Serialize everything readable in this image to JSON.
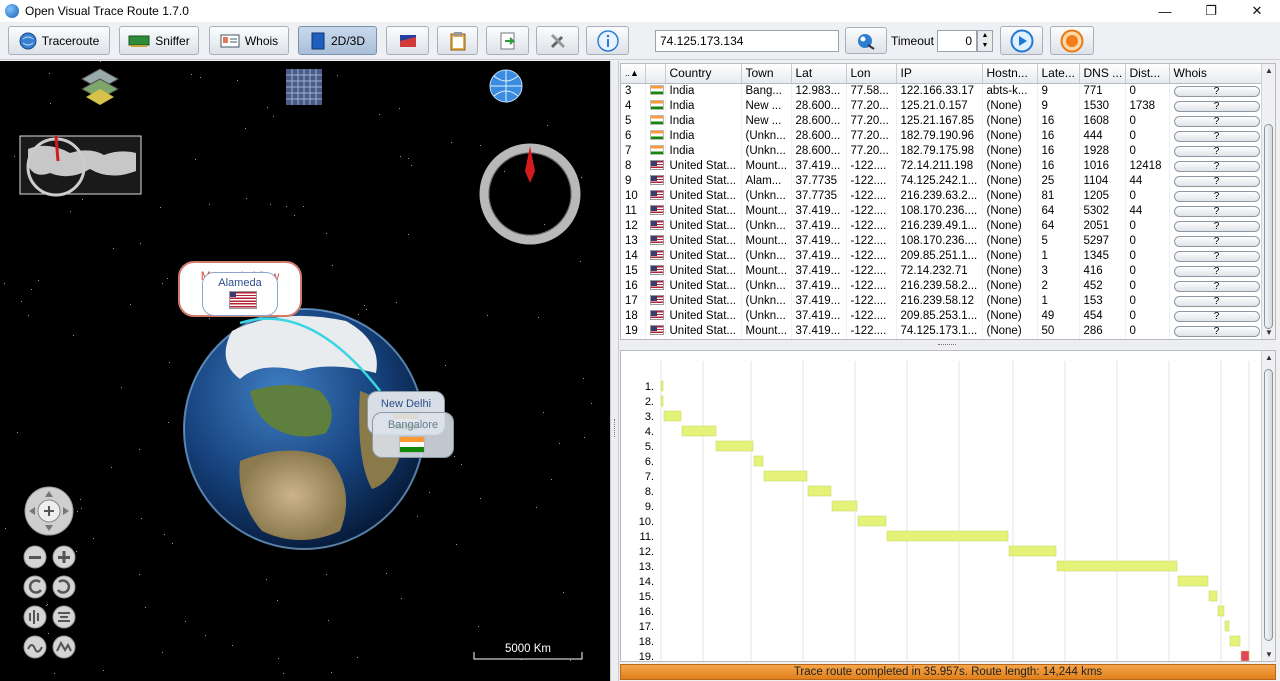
{
  "window": {
    "title": "Open Visual Trace Route 1.7.0",
    "minimize": "—",
    "restore": "❐",
    "close": "✕"
  },
  "toolbar": {
    "traceroute_label": "Traceroute",
    "sniffer_label": "Sniffer",
    "whois_label": "Whois",
    "view_label": "2D/3D",
    "target_ip": "74.125.173.134",
    "timeout_label": "Timeout",
    "timeout_value": "0"
  },
  "map": {
    "labels": {
      "mountain_view": "Mountain View",
      "alameda": "Alameda",
      "new_delhi": "New Delhi",
      "bangalore": "Bangalore"
    },
    "scale_label": "5000 Km"
  },
  "table": {
    "sort_indicator": "..▲",
    "headers": [
      "Country",
      "Town",
      "Lat",
      "Lon",
      "IP",
      "Hostn...",
      "Late...",
      "DNS ...",
      "Dist...",
      "Whois"
    ],
    "whois_button": "?",
    "rows": [
      {
        "num": "3",
        "flag": "in",
        "country": "India",
        "town": "Bang...",
        "lat": "12.983...",
        "lon": "77.58...",
        "ip": "122.166.33.17",
        "host": "abts-k...",
        "lat_ms": "9",
        "dns": "771",
        "dist": "0"
      },
      {
        "num": "4",
        "flag": "in",
        "country": "India",
        "town": "New ...",
        "lat": "28.600...",
        "lon": "77.20...",
        "ip": "125.21.0.157",
        "host": "(None)",
        "lat_ms": "9",
        "dns": "1530",
        "dist": "1738"
      },
      {
        "num": "5",
        "flag": "in",
        "country": "India",
        "town": "New ...",
        "lat": "28.600...",
        "lon": "77.20...",
        "ip": "125.21.167.85",
        "host": "(None)",
        "lat_ms": "16",
        "dns": "1608",
        "dist": "0"
      },
      {
        "num": "6",
        "flag": "in",
        "country": "India",
        "town": "(Unkn...",
        "lat": "28.600...",
        "lon": "77.20...",
        "ip": "182.79.190.96",
        "host": "(None)",
        "lat_ms": "16",
        "dns": "444",
        "dist": "0"
      },
      {
        "num": "7",
        "flag": "in",
        "country": "India",
        "town": "(Unkn...",
        "lat": "28.600...",
        "lon": "77.20...",
        "ip": "182.79.175.98",
        "host": "(None)",
        "lat_ms": "16",
        "dns": "1928",
        "dist": "0"
      },
      {
        "num": "8",
        "flag": "us",
        "country": "United Stat...",
        "town": "Mount...",
        "lat": "37.419...",
        "lon": "-122....",
        "ip": "72.14.211.198",
        "host": "(None)",
        "lat_ms": "16",
        "dns": "1016",
        "dist": "12418"
      },
      {
        "num": "9",
        "flag": "us",
        "country": "United Stat...",
        "town": "Alam...",
        "lat": "37.7735",
        "lon": "-122....",
        "ip": "74.125.242.1...",
        "host": "(None)",
        "lat_ms": "25",
        "dns": "1104",
        "dist": "44"
      },
      {
        "num": "10",
        "flag": "us",
        "country": "United Stat...",
        "town": "(Unkn...",
        "lat": "37.7735",
        "lon": "-122....",
        "ip": "216.239.63.2...",
        "host": "(None)",
        "lat_ms": "81",
        "dns": "1205",
        "dist": "0"
      },
      {
        "num": "11",
        "flag": "us",
        "country": "United Stat...",
        "town": "Mount...",
        "lat": "37.419...",
        "lon": "-122....",
        "ip": "108.170.236....",
        "host": "(None)",
        "lat_ms": "64",
        "dns": "5302",
        "dist": "44"
      },
      {
        "num": "12",
        "flag": "us",
        "country": "United Stat...",
        "town": "(Unkn...",
        "lat": "37.419...",
        "lon": "-122....",
        "ip": "216.239.49.1...",
        "host": "(None)",
        "lat_ms": "64",
        "dns": "2051",
        "dist": "0"
      },
      {
        "num": "13",
        "flag": "us",
        "country": "United Stat...",
        "town": "Mount...",
        "lat": "37.419...",
        "lon": "-122....",
        "ip": "108.170.236....",
        "host": "(None)",
        "lat_ms": "5",
        "dns": "5297",
        "dist": "0"
      },
      {
        "num": "14",
        "flag": "us",
        "country": "United Stat...",
        "town": "(Unkn...",
        "lat": "37.419...",
        "lon": "-122....",
        "ip": "209.85.251.1...",
        "host": "(None)",
        "lat_ms": "1",
        "dns": "1345",
        "dist": "0"
      },
      {
        "num": "15",
        "flag": "us",
        "country": "United Stat...",
        "town": "Mount...",
        "lat": "37.419...",
        "lon": "-122....",
        "ip": "72.14.232.71",
        "host": "(None)",
        "lat_ms": "3",
        "dns": "416",
        "dist": "0"
      },
      {
        "num": "16",
        "flag": "us",
        "country": "United Stat...",
        "town": "(Unkn...",
        "lat": "37.419...",
        "lon": "-122....",
        "ip": "216.239.58.2...",
        "host": "(None)",
        "lat_ms": "2",
        "dns": "452",
        "dist": "0"
      },
      {
        "num": "17",
        "flag": "us",
        "country": "United Stat...",
        "town": "(Unkn...",
        "lat": "37.419...",
        "lon": "-122....",
        "ip": "216.239.58.12",
        "host": "(None)",
        "lat_ms": "1",
        "dns": "153",
        "dist": "0"
      },
      {
        "num": "18",
        "flag": "us",
        "country": "United Stat...",
        "town": "(Unkn...",
        "lat": "37.419...",
        "lon": "-122....",
        "ip": "209.85.253.1...",
        "host": "(None)",
        "lat_ms": "49",
        "dns": "454",
        "dist": "0"
      },
      {
        "num": "19",
        "flag": "us",
        "country": "United Stat...",
        "town": "Mount...",
        "lat": "37.419...",
        "lon": "-122....",
        "ip": "74.125.173.1...",
        "host": "(None)",
        "lat_ms": "50",
        "dns": "286",
        "dist": "0"
      }
    ]
  },
  "gantt": {
    "hop_labels": [
      "1.",
      "2.",
      "3.",
      "4.",
      "5.",
      "6.",
      "7.",
      "8.",
      "9.",
      "10.",
      "11.",
      "12.",
      "13.",
      "14.",
      "15.",
      "16.",
      "17.",
      "18.",
      "19."
    ],
    "bar_color": "#e4f27a",
    "last_color": "#e0485a"
  },
  "status": {
    "text": "Trace route completed in 35.957s. Route length: 14,244 kms",
    "color": "#f0962e"
  }
}
